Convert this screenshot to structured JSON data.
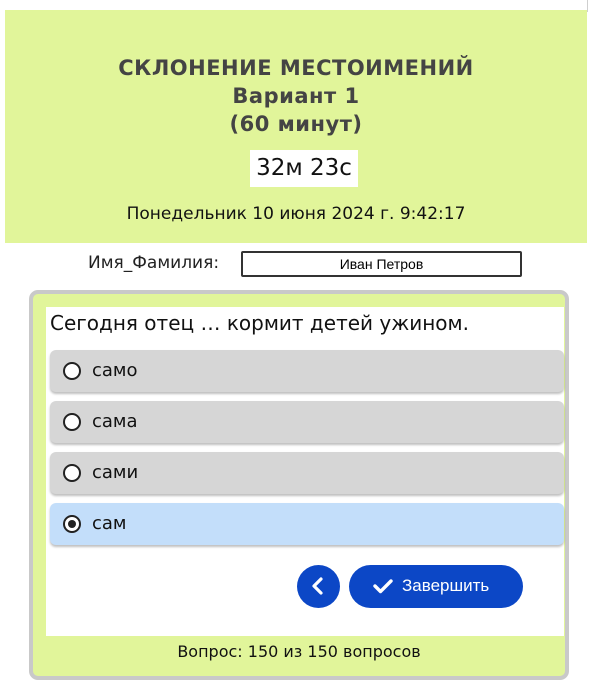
{
  "header": {
    "title_line1": "СКЛОНЕНИЕ МЕСТОИМЕНИЙ",
    "title_line2": "Вариант 1",
    "title_line3": "(60 минут)",
    "timer": "32м 23с",
    "datetime": "Понедельник 10 июня 2024 г. 9:42:17"
  },
  "student": {
    "label": "Имя_Фамилия:",
    "value": "Иван Петров"
  },
  "quiz": {
    "question": "Сегодня отец … кормит детей ужином.",
    "options": [
      {
        "label": "само",
        "selected": false
      },
      {
        "label": "сама",
        "selected": false
      },
      {
        "label": "сами",
        "selected": false
      },
      {
        "label": "сам",
        "selected": true
      }
    ],
    "finish_label": "Завершить",
    "counter": "Вопрос: 150 из 150 вопросов"
  },
  "icons": {
    "back": "chevron-left-icon",
    "finish": "check-icon"
  },
  "colors": {
    "accent": "#0c47c6",
    "header_bg": "#e1f59a",
    "selected_option_bg": "#c3defa",
    "option_bg": "#d6d6d6"
  }
}
